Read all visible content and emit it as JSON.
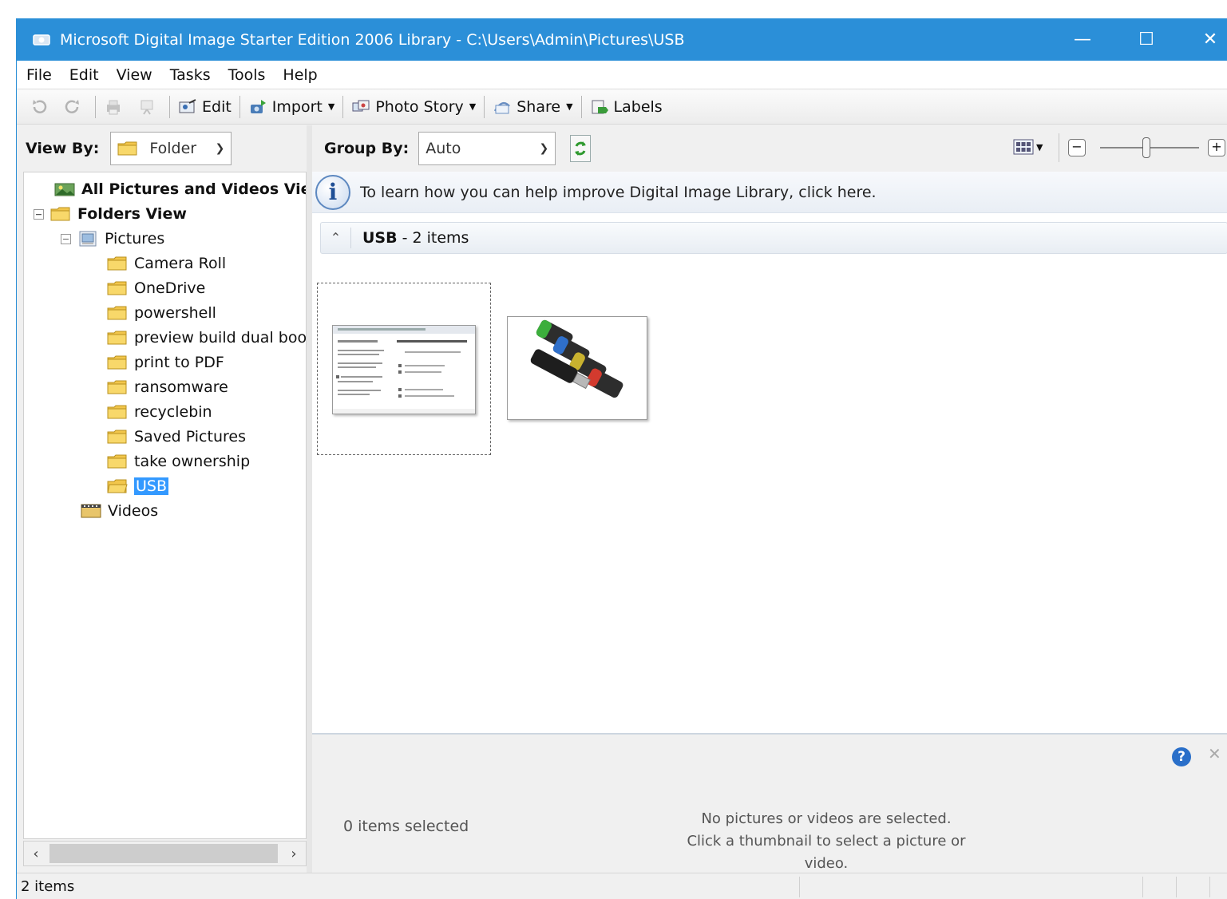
{
  "window": {
    "title": "Microsoft Digital Image Starter Edition 2006 Library - C:\\Users\\Admin\\Pictures\\USB",
    "minimize_glyph": "—",
    "maximize_glyph": "☐",
    "close_glyph": "✕"
  },
  "menu": [
    "File",
    "Edit",
    "View",
    "Tasks",
    "Tools",
    "Help"
  ],
  "toolbar": {
    "edit_label": "Edit",
    "import_label": "Import",
    "photo_story_label": "Photo Story",
    "share_label": "Share",
    "labels_label": "Labels"
  },
  "view_by": {
    "label": "View By:",
    "value": "Folder"
  },
  "group_by": {
    "label": "Group By:",
    "value": "Auto"
  },
  "tree": {
    "all_pictures": "All Pictures and Videos View",
    "folders_view": "Folders View",
    "pictures": "Pictures",
    "subfolders": [
      "Camera Roll",
      "OneDrive",
      "powershell",
      "preview build dual boot",
      "print to PDF",
      "ransomware",
      "recyclebin",
      "Saved Pictures",
      "take ownership",
      "USB"
    ],
    "videos": "Videos",
    "selected": "USB"
  },
  "infobar": {
    "message": "To learn how you can help improve Digital Image Library, click here."
  },
  "group": {
    "name": "USB",
    "count": "- 2 items"
  },
  "details": {
    "selected_count": "0 items selected",
    "no_selection_line1": "No pictures or videos are selected.",
    "no_selection_line2": "Click a thumbnail to select a picture or video."
  },
  "status": {
    "items": "2 items"
  },
  "colors": {
    "titlebar": "#2b8fd8",
    "selection": "#3399ff"
  }
}
